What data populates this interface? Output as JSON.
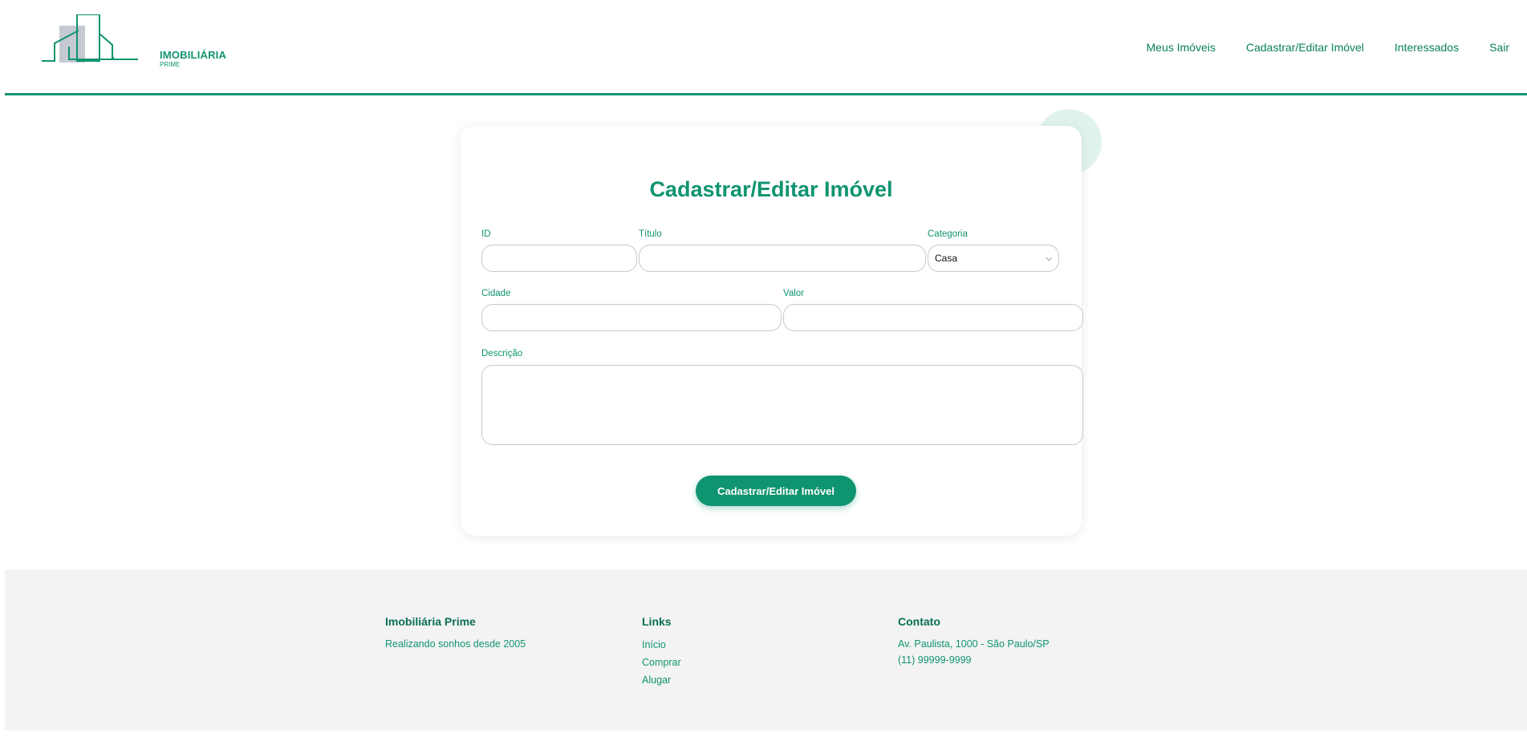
{
  "brand": {
    "name": "IMOBILIÁRIA",
    "sub": "PRIME"
  },
  "nav": [
    "Meus Imóveis",
    "Cadastrar/Editar Imóvel",
    "Interessados",
    "Sair"
  ],
  "form": {
    "title": "Cadastrar/Editar Imóvel",
    "id_label": "ID",
    "titulo_label": "Título",
    "categoria_label": "Categoria",
    "categoria_value": "Casa",
    "cidade_label": "Cidade",
    "valor_label": "Valor",
    "descricao_label": "Descrição",
    "submit": "Cadastrar/Editar Imóvel"
  },
  "footer": {
    "about_title": "Imobiliária Prime",
    "about_text": "Realizando sonhos desde 2005",
    "links_title": "Links",
    "links": [
      "Início",
      "Comprar",
      "Alugar"
    ],
    "contact_title": "Contato",
    "address": "Av. Paulista, 1000 - São Paulo/SP",
    "phone": "(11) 99999-9999"
  },
  "colors": {
    "accent": "#0f9470",
    "footer_bg": "#f3f3f3"
  }
}
